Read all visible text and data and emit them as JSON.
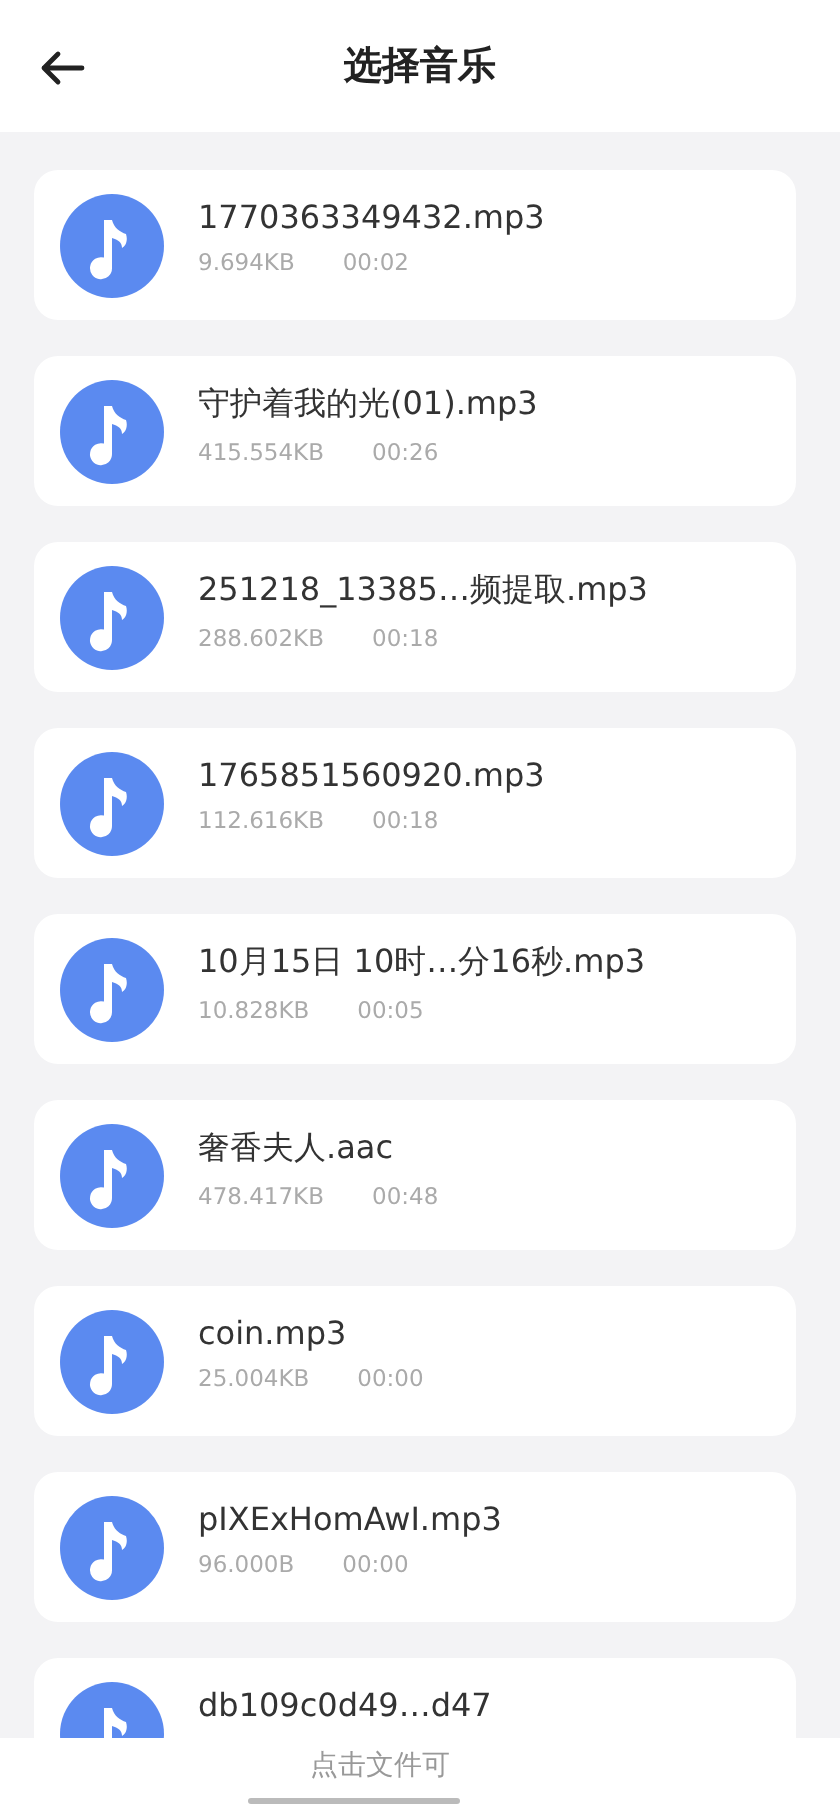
{
  "header": {
    "title": "选择音乐"
  },
  "files": [
    {
      "name": "1770363349432.mp3",
      "size": "9.694KB",
      "duration": "00:02"
    },
    {
      "name": "守护着我的光(01).mp3",
      "size": "415.554KB",
      "duration": "00:26"
    },
    {
      "name": "251218_13385…频提取.mp3",
      "size": "288.602KB",
      "duration": "00:18"
    },
    {
      "name": "1765851560920.mp3",
      "size": "112.616KB",
      "duration": "00:18"
    },
    {
      "name": "10月15日 10时…分16秒.mp3",
      "size": "10.828KB",
      "duration": "00:05"
    },
    {
      "name": "奢香夫人.aac",
      "size": "478.417KB",
      "duration": "00:48"
    },
    {
      "name": "coin.mp3",
      "size": "25.004KB",
      "duration": "00:00"
    },
    {
      "name": "pIXExHomAwI.mp3",
      "size": "96.000B",
      "duration": "00:00"
    },
    {
      "name": "db109c0d49…d47"
    }
  ],
  "hint": "点击文件可"
}
